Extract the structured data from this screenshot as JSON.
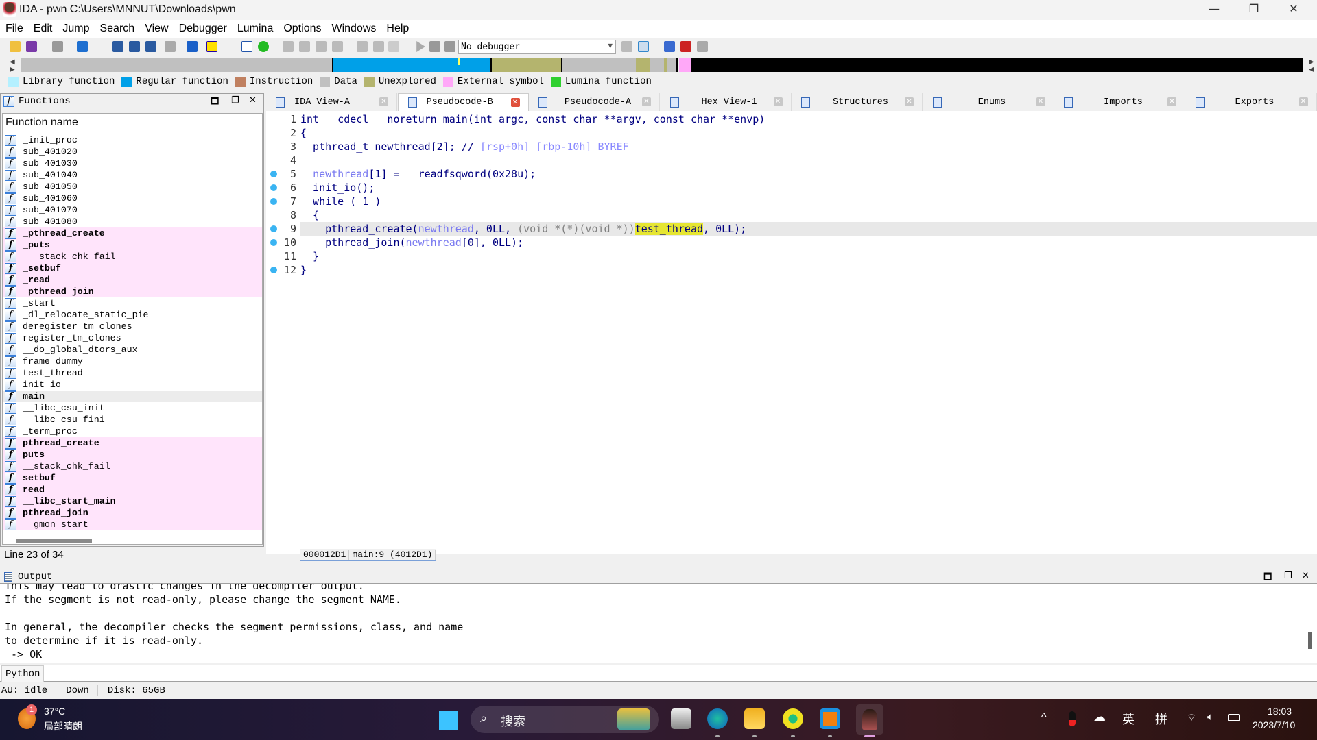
{
  "window": {
    "title": "IDA - pwn C:\\Users\\MNNUT\\Downloads\\pwn",
    "minimize": "—",
    "restore": "❐",
    "close": "✕"
  },
  "menu": [
    "File",
    "Edit",
    "Jump",
    "Search",
    "View",
    "Debugger",
    "Lumina",
    "Options",
    "Windows",
    "Help"
  ],
  "toolbar": {
    "debugger_select": "No debugger"
  },
  "legend": [
    {
      "label": "Library function",
      "color": "#b4f0ff"
    },
    {
      "label": "Regular function",
      "color": "#00a0e8"
    },
    {
      "label": "Instruction",
      "color": "#c08060"
    },
    {
      "label": "Data",
      "color": "#c0c0c0"
    },
    {
      "label": "Unexplored",
      "color": "#b4b46e"
    },
    {
      "label": "External symbol",
      "color": "#ffa8f8"
    },
    {
      "label": "Lumina function",
      "color": "#30d030"
    }
  ],
  "functions": {
    "title": "Functions",
    "column": "Function name",
    "status": "Line 23 of 34",
    "items": [
      {
        "name": "_init_proc",
        "bold": false,
        "external": false
      },
      {
        "name": "sub_401020",
        "bold": false,
        "external": false
      },
      {
        "name": "sub_401030",
        "bold": false,
        "external": false
      },
      {
        "name": "sub_401040",
        "bold": false,
        "external": false
      },
      {
        "name": "sub_401050",
        "bold": false,
        "external": false
      },
      {
        "name": "sub_401060",
        "bold": false,
        "external": false
      },
      {
        "name": "sub_401070",
        "bold": false,
        "external": false
      },
      {
        "name": "sub_401080",
        "bold": false,
        "external": false
      },
      {
        "name": "_pthread_create",
        "bold": true,
        "external": true
      },
      {
        "name": "_puts",
        "bold": true,
        "external": true
      },
      {
        "name": "___stack_chk_fail",
        "bold": false,
        "external": true
      },
      {
        "name": "_setbuf",
        "bold": true,
        "external": true
      },
      {
        "name": "_read",
        "bold": true,
        "external": true
      },
      {
        "name": "_pthread_join",
        "bold": true,
        "external": true
      },
      {
        "name": "_start",
        "bold": false,
        "external": false
      },
      {
        "name": "_dl_relocate_static_pie",
        "bold": false,
        "external": false
      },
      {
        "name": "deregister_tm_clones",
        "bold": false,
        "external": false
      },
      {
        "name": "register_tm_clones",
        "bold": false,
        "external": false
      },
      {
        "name": "__do_global_dtors_aux",
        "bold": false,
        "external": false
      },
      {
        "name": "frame_dummy",
        "bold": false,
        "external": false
      },
      {
        "name": "test_thread",
        "bold": false,
        "external": false
      },
      {
        "name": "init_io",
        "bold": false,
        "external": false
      },
      {
        "name": "main",
        "bold": true,
        "external": false,
        "selected": true
      },
      {
        "name": "__libc_csu_init",
        "bold": false,
        "external": false
      },
      {
        "name": "__libc_csu_fini",
        "bold": false,
        "external": false
      },
      {
        "name": "_term_proc",
        "bold": false,
        "external": false
      },
      {
        "name": "pthread_create",
        "bold": true,
        "external": true
      },
      {
        "name": "puts",
        "bold": true,
        "external": true
      },
      {
        "name": "__stack_chk_fail",
        "bold": false,
        "external": true
      },
      {
        "name": "setbuf",
        "bold": true,
        "external": true
      },
      {
        "name": "read",
        "bold": true,
        "external": true
      },
      {
        "name": "__libc_start_main",
        "bold": true,
        "external": true
      },
      {
        "name": "pthread_join",
        "bold": true,
        "external": true
      },
      {
        "name": "__gmon_start__",
        "bold": false,
        "external": true
      }
    ]
  },
  "tabs": [
    {
      "label": "IDA View-A",
      "active": false
    },
    {
      "label": "Pseudocode-B",
      "active": true
    },
    {
      "label": "Pseudocode-A",
      "active": false
    },
    {
      "label": "Hex View-1",
      "active": false
    },
    {
      "label": "Structures",
      "active": false
    },
    {
      "label": "Enums",
      "active": false
    },
    {
      "label": "Imports",
      "active": false
    },
    {
      "label": "Exports",
      "active": false
    }
  ],
  "code": {
    "lines": [
      {
        "n": "1",
        "bp": false,
        "tokens": [
          [
            "int __cdecl __noreturn main(int argc, const char **argv, const char **envp)",
            ""
          ]
        ]
      },
      {
        "n": "2",
        "bp": false,
        "tokens": [
          [
            "{",
            ""
          ]
        ]
      },
      {
        "n": "3",
        "bp": false,
        "tokens": [
          [
            "  pthread_t newthread[2]; // ",
            ""
          ],
          [
            "[rsp+0h] [rbp-10h] BYREF",
            "cmt"
          ]
        ]
      },
      {
        "n": "4",
        "bp": false,
        "tokens": []
      },
      {
        "n": "5",
        "bp": true,
        "tokens": [
          [
            "  ",
            ""
          ],
          [
            "newthread",
            "var"
          ],
          [
            "[1] = __readfsqword(0x28u);",
            ""
          ]
        ]
      },
      {
        "n": "6",
        "bp": true,
        "tokens": [
          [
            "  init_io();",
            ""
          ]
        ]
      },
      {
        "n": "7",
        "bp": true,
        "tokens": [
          [
            "  while ( 1 )",
            ""
          ]
        ]
      },
      {
        "n": "8",
        "bp": false,
        "tokens": [
          [
            "  {",
            ""
          ]
        ]
      },
      {
        "n": "9",
        "bp": true,
        "hl": true,
        "tokens": [
          [
            "    pthread_create(",
            ""
          ],
          [
            "newthread",
            "var"
          ],
          [
            ", 0LL, ",
            ""
          ],
          [
            "(void *(*)(void *))",
            "cast"
          ],
          [
            "test_thread",
            "hl"
          ],
          [
            ", 0LL);",
            ""
          ]
        ]
      },
      {
        "n": "10",
        "bp": true,
        "tokens": [
          [
            "    pthread_join(",
            ""
          ],
          [
            "newthread",
            "var"
          ],
          [
            "[0], 0LL);",
            ""
          ]
        ]
      },
      {
        "n": "11",
        "bp": false,
        "tokens": [
          [
            "  }",
            ""
          ]
        ]
      },
      {
        "n": "12",
        "bp": true,
        "tokens": [
          [
            "}",
            ""
          ]
        ]
      }
    ],
    "status_addr": "000012D1",
    "status_loc": "main:9 (4012D1)"
  },
  "output": {
    "title": "Output",
    "lines": [
      "This may lead to drastic changes in the decompiler output.",
      "If the segment is not read-only, please change the segment NAME.",
      "",
      "In general, the decompiler checks the segment permissions, class, and name",
      "to determine if it is read-only.",
      " -> OK"
    ],
    "python_label": "Python"
  },
  "status": {
    "au": "AU:  idle",
    "direction": "Down",
    "disk": "Disk: 65GB"
  },
  "taskbar": {
    "weather_temp": "37°C",
    "weather_desc": "局部晴朗",
    "weather_badge": "1",
    "search_placeholder": "搜索",
    "ime_lang": "英",
    "ime_mode": "拼",
    "time": "18:03",
    "date": "2023/7/10"
  }
}
